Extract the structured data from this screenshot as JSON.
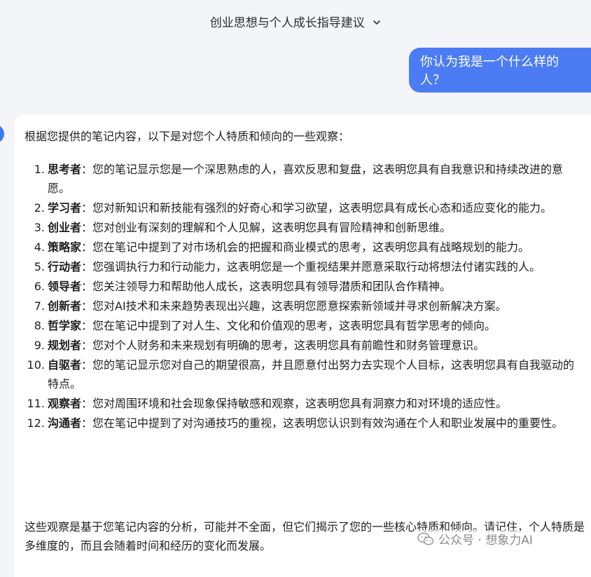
{
  "header": {
    "title": "创业思想与个人成长指导建议"
  },
  "user_message": {
    "text": "你认为我是一个什么样的人？"
  },
  "answer": {
    "intro": "根据您提供的笔记内容，以下是对您个人特质和倾向的一些观察：",
    "items": [
      {
        "num": "1.",
        "term": "思考者",
        "text": "：您的笔记显示您是一个深思熟虑的人，喜欢反思和复盘，这表明您具有自我意识和持续改进的意愿。"
      },
      {
        "num": "2.",
        "term": "学习者",
        "text": "：您对新知识和新技能有强烈的好奇心和学习欲望，这表明您具有成长心态和适应变化的能力。"
      },
      {
        "num": "3.",
        "term": "创业者",
        "text": "：您对创业有深刻的理解和个人见解，这表明您具有冒险精神和创新思维。"
      },
      {
        "num": "4.",
        "term": "策略家",
        "text": "：您在笔记中提到了对市场机会的把握和商业模式的思考，这表明您具有战略规划的能力。"
      },
      {
        "num": "5.",
        "term": "行动者",
        "text": "：您强调执行力和行动能力，这表明您是一个重视结果并愿意采取行动将想法付诸实践的人。"
      },
      {
        "num": "6.",
        "term": "领导者",
        "text": "：您关注领导力和帮助他人成长，这表明您具有领导潜质和团队合作精神。"
      },
      {
        "num": "7.",
        "term": "创新者",
        "text": "：您对AI技术和未来趋势表现出兴趣，这表明您愿意探索新领域并寻求创新解决方案。"
      },
      {
        "num": "8.",
        "term": "哲学家",
        "text": "：您在笔记中提到了对人生、文化和价值观的思考，这表明您具有哲学思考的倾向。"
      },
      {
        "num": "9.",
        "term": "规划者",
        "text": "：您对个人财务和未来规划有明确的思考，这表明您具有前瞻性和财务管理意识。"
      },
      {
        "num": "10.",
        "term": "自驱者",
        "text": "：您的笔记显示您对自己的期望很高，并且愿意付出努力去实现个人目标，这表明您具有自我驱动的特点。"
      },
      {
        "num": "11.",
        "term": "观察者",
        "text": "：您对周围环境和社会现象保持敏感和观察，这表明您具有洞察力和对环境的适应性。"
      },
      {
        "num": "12.",
        "term": "沟通者",
        "text": "：您在笔记中提到了对沟通技巧的重视，这表明您认识到有效沟通在个人和职业发展中的重要性。"
      }
    ],
    "conclusion": "这些观察是基于您笔记内容的分析，可能并不全面，但它们揭示了您的一些核心特质和倾向。请记住，个人特质是多维度的，而且会随着时间和经历的变化而发展。"
  },
  "watermark": {
    "text": "公众号 · 想象力AI",
    "icon": "wechat-icon"
  },
  "colors": {
    "user_bubble": "#4b7cf3",
    "page_bg": "#f4f5f9",
    "card_bg": "#ffffff"
  }
}
